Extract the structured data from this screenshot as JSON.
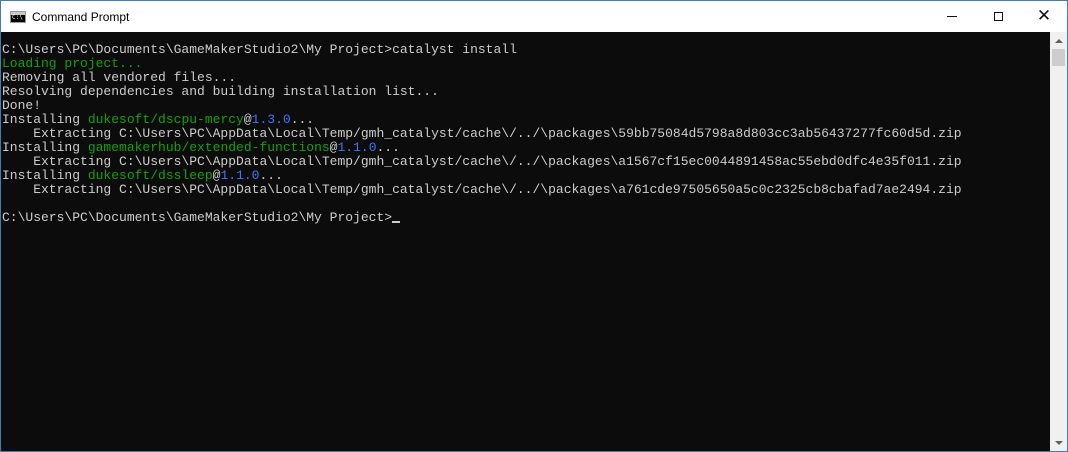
{
  "window": {
    "title": "Command Prompt",
    "icon": "cmd-icon",
    "controls": {
      "minimize": "minimize-icon",
      "maximize": "maximize-icon",
      "close": "close-icon"
    }
  },
  "colors": {
    "console_bg": "#0c0c0c",
    "console_text": "#cccccc",
    "package_green": "#13a10e",
    "version_blue": "#3b78ff"
  },
  "console": {
    "lines": [
      {
        "text": "C:\\Users\\PC\\Documents\\GameMakerStudio2\\My Project>catalyst install"
      },
      {
        "text": "Loading project...",
        "color": "green"
      },
      {
        "text": "Removing all vendored files..."
      },
      {
        "text": "Resolving dependencies and building installation list..."
      },
      {
        "text": "Done!"
      },
      {
        "prefix": "Installing ",
        "package": "dukesoft/dscpu-mercy",
        "at": "@",
        "version": "1.3.0",
        "suffix": "..."
      },
      {
        "text": "    Extracting C:\\Users\\PC\\AppData\\Local\\Temp/gmh_catalyst/cache\\/../\\packages\\59bb75084d5798a8d803cc3ab56437277fc60d5d.zip"
      },
      {
        "prefix": "Installing ",
        "package": "gamemakerhub/extended-functions",
        "at": "@",
        "version": "1.1.0",
        "suffix": "..."
      },
      {
        "text": "    Extracting C:\\Users\\PC\\AppData\\Local\\Temp/gmh_catalyst/cache\\/../\\packages\\a1567cf15ec0044891458ac55ebd0dfc4e35f011.zip"
      },
      {
        "prefix": "Installing ",
        "package": "dukesoft/dssleep",
        "at": "@",
        "version": "1.1.0",
        "suffix": "..."
      },
      {
        "text": "    Extracting C:\\Users\\PC\\AppData\\Local\\Temp/gmh_catalyst/cache\\/../\\packages\\a761cde97505650a5c0c2325cb8cbafad7ae2494.zip"
      },
      {
        "text": ""
      },
      {
        "text": "C:\\Users\\PC\\Documents\\GameMakerStudio2\\My Project>",
        "cursor": true
      }
    ]
  }
}
